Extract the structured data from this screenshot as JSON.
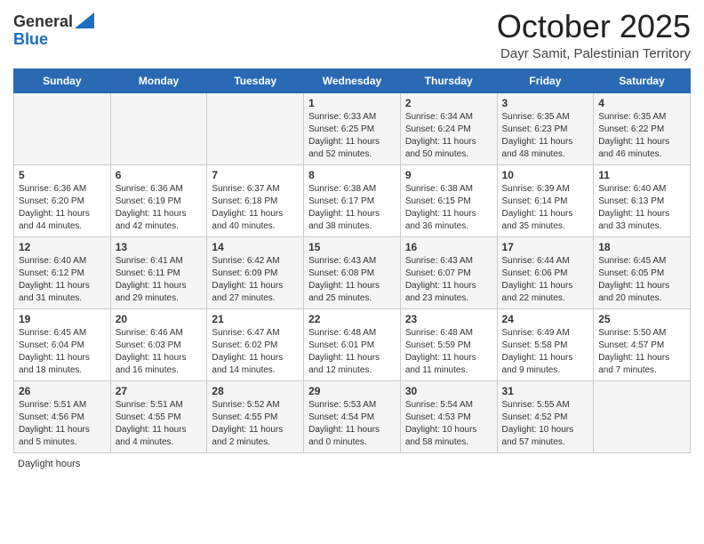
{
  "header": {
    "logo_general": "General",
    "logo_blue": "Blue",
    "month_title": "October 2025",
    "subtitle": "Dayr Samit, Palestinian Territory"
  },
  "days_of_week": [
    "Sunday",
    "Monday",
    "Tuesday",
    "Wednesday",
    "Thursday",
    "Friday",
    "Saturday"
  ],
  "footer": {
    "daylight_label": "Daylight hours"
  },
  "weeks": [
    [
      {
        "num": "",
        "info": ""
      },
      {
        "num": "",
        "info": ""
      },
      {
        "num": "",
        "info": ""
      },
      {
        "num": "1",
        "info": "Sunrise: 6:33 AM\nSunset: 6:25 PM\nDaylight: 11 hours and 52 minutes."
      },
      {
        "num": "2",
        "info": "Sunrise: 6:34 AM\nSunset: 6:24 PM\nDaylight: 11 hours and 50 minutes."
      },
      {
        "num": "3",
        "info": "Sunrise: 6:35 AM\nSunset: 6:23 PM\nDaylight: 11 hours and 48 minutes."
      },
      {
        "num": "4",
        "info": "Sunrise: 6:35 AM\nSunset: 6:22 PM\nDaylight: 11 hours and 46 minutes."
      }
    ],
    [
      {
        "num": "5",
        "info": "Sunrise: 6:36 AM\nSunset: 6:20 PM\nDaylight: 11 hours and 44 minutes."
      },
      {
        "num": "6",
        "info": "Sunrise: 6:36 AM\nSunset: 6:19 PM\nDaylight: 11 hours and 42 minutes."
      },
      {
        "num": "7",
        "info": "Sunrise: 6:37 AM\nSunset: 6:18 PM\nDaylight: 11 hours and 40 minutes."
      },
      {
        "num": "8",
        "info": "Sunrise: 6:38 AM\nSunset: 6:17 PM\nDaylight: 11 hours and 38 minutes."
      },
      {
        "num": "9",
        "info": "Sunrise: 6:38 AM\nSunset: 6:15 PM\nDaylight: 11 hours and 36 minutes."
      },
      {
        "num": "10",
        "info": "Sunrise: 6:39 AM\nSunset: 6:14 PM\nDaylight: 11 hours and 35 minutes."
      },
      {
        "num": "11",
        "info": "Sunrise: 6:40 AM\nSunset: 6:13 PM\nDaylight: 11 hours and 33 minutes."
      }
    ],
    [
      {
        "num": "12",
        "info": "Sunrise: 6:40 AM\nSunset: 6:12 PM\nDaylight: 11 hours and 31 minutes."
      },
      {
        "num": "13",
        "info": "Sunrise: 6:41 AM\nSunset: 6:11 PM\nDaylight: 11 hours and 29 minutes."
      },
      {
        "num": "14",
        "info": "Sunrise: 6:42 AM\nSunset: 6:09 PM\nDaylight: 11 hours and 27 minutes."
      },
      {
        "num": "15",
        "info": "Sunrise: 6:43 AM\nSunset: 6:08 PM\nDaylight: 11 hours and 25 minutes."
      },
      {
        "num": "16",
        "info": "Sunrise: 6:43 AM\nSunset: 6:07 PM\nDaylight: 11 hours and 23 minutes."
      },
      {
        "num": "17",
        "info": "Sunrise: 6:44 AM\nSunset: 6:06 PM\nDaylight: 11 hours and 22 minutes."
      },
      {
        "num": "18",
        "info": "Sunrise: 6:45 AM\nSunset: 6:05 PM\nDaylight: 11 hours and 20 minutes."
      }
    ],
    [
      {
        "num": "19",
        "info": "Sunrise: 6:45 AM\nSunset: 6:04 PM\nDaylight: 11 hours and 18 minutes."
      },
      {
        "num": "20",
        "info": "Sunrise: 6:46 AM\nSunset: 6:03 PM\nDaylight: 11 hours and 16 minutes."
      },
      {
        "num": "21",
        "info": "Sunrise: 6:47 AM\nSunset: 6:02 PM\nDaylight: 11 hours and 14 minutes."
      },
      {
        "num": "22",
        "info": "Sunrise: 6:48 AM\nSunset: 6:01 PM\nDaylight: 11 hours and 12 minutes."
      },
      {
        "num": "23",
        "info": "Sunrise: 6:48 AM\nSunset: 5:59 PM\nDaylight: 11 hours and 11 minutes."
      },
      {
        "num": "24",
        "info": "Sunrise: 6:49 AM\nSunset: 5:58 PM\nDaylight: 11 hours and 9 minutes."
      },
      {
        "num": "25",
        "info": "Sunrise: 5:50 AM\nSunset: 4:57 PM\nDaylight: 11 hours and 7 minutes."
      }
    ],
    [
      {
        "num": "26",
        "info": "Sunrise: 5:51 AM\nSunset: 4:56 PM\nDaylight: 11 hours and 5 minutes."
      },
      {
        "num": "27",
        "info": "Sunrise: 5:51 AM\nSunset: 4:55 PM\nDaylight: 11 hours and 4 minutes."
      },
      {
        "num": "28",
        "info": "Sunrise: 5:52 AM\nSunset: 4:55 PM\nDaylight: 11 hours and 2 minutes."
      },
      {
        "num": "29",
        "info": "Sunrise: 5:53 AM\nSunset: 4:54 PM\nDaylight: 11 hours and 0 minutes."
      },
      {
        "num": "30",
        "info": "Sunrise: 5:54 AM\nSunset: 4:53 PM\nDaylight: 10 hours and 58 minutes."
      },
      {
        "num": "31",
        "info": "Sunrise: 5:55 AM\nSunset: 4:52 PM\nDaylight: 10 hours and 57 minutes."
      },
      {
        "num": "",
        "info": ""
      }
    ]
  ]
}
